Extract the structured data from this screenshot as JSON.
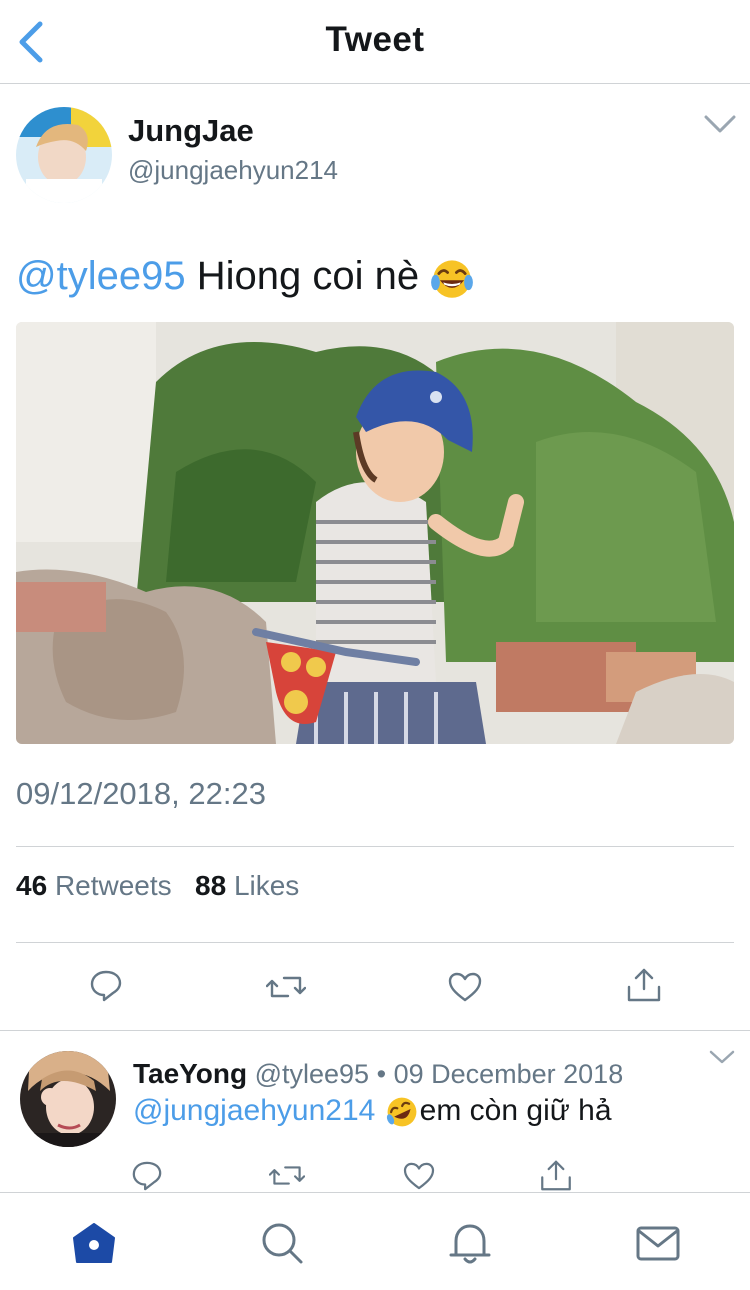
{
  "header": {
    "title": "Tweet"
  },
  "tweet": {
    "author_name": "JungJae",
    "author_handle": "@jungjaehyun214",
    "mention": "@tylee95",
    "text": "Hiong coi nè",
    "emoji_icon": "face-with-tears-of-joy-icon",
    "timestamp": "09/12/2018, 22:23",
    "retweets_count": "46",
    "retweets_label": "Retweets",
    "likes_count": "88",
    "likes_label": "Likes"
  },
  "reply": {
    "author_name": "TaeYong",
    "author_handle": "@tylee95",
    "separator": "•",
    "date": "09 December 2018",
    "mention": "@jungjaehyun214",
    "emoji_icon": "rolling-on-floor-laughing-icon",
    "text": "em còn giữ hả"
  },
  "tabbar": {
    "items": [
      "home-icon",
      "search-icon",
      "notifications-icon",
      "messages-icon"
    ],
    "active": "home-icon"
  },
  "colors": {
    "accent": "#4c9de8",
    "active_tab": "#1c4aa6",
    "secondary_text": "#657786",
    "divider": "#d0d3d6"
  }
}
